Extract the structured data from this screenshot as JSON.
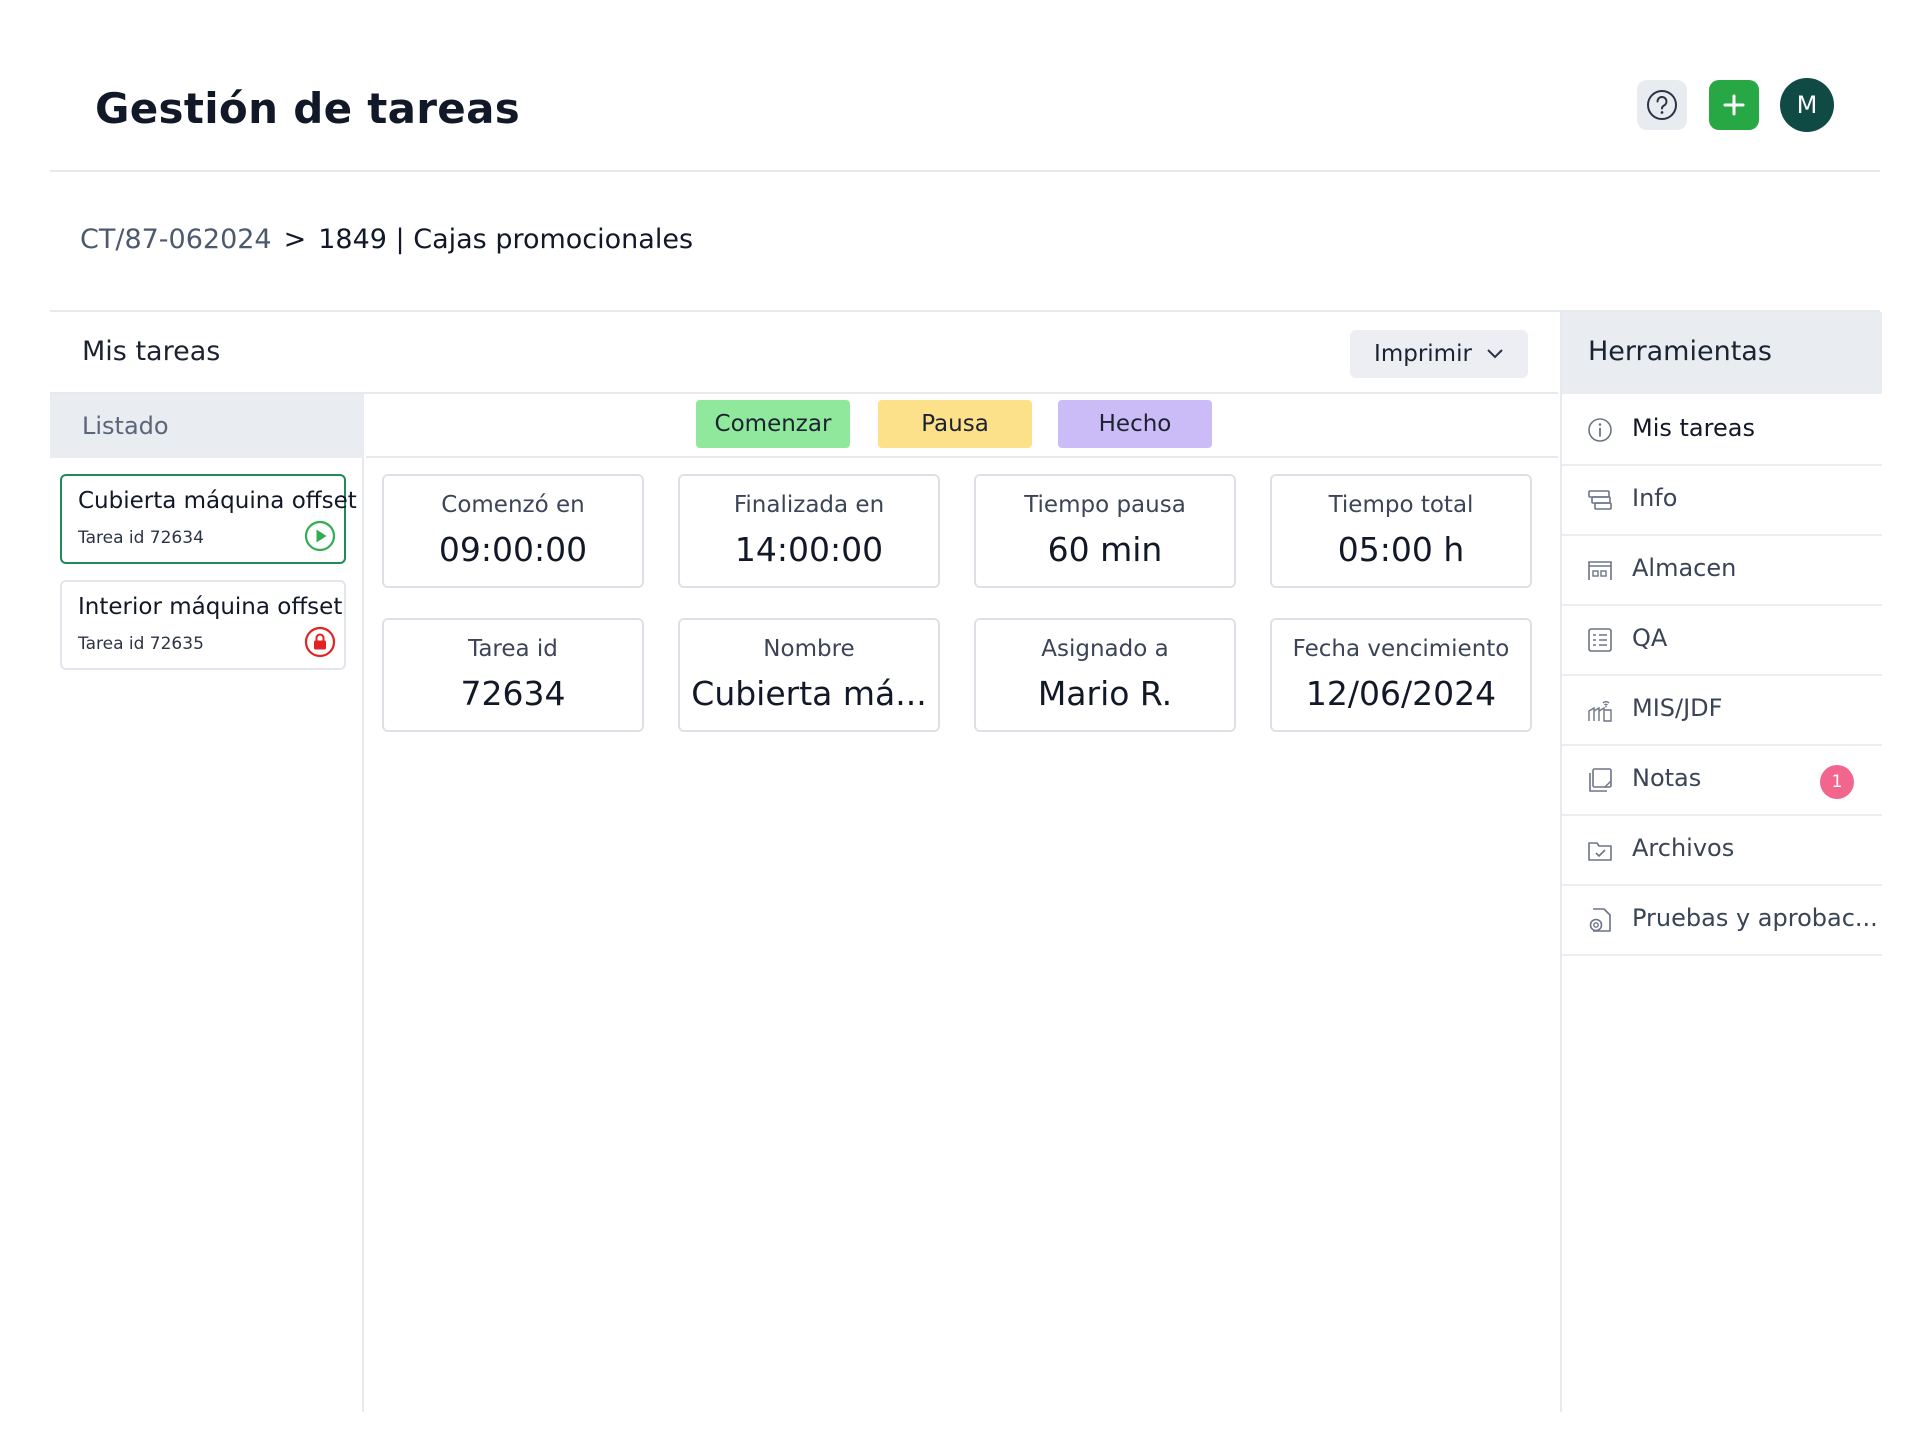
{
  "header": {
    "title": "Gestión de tareas",
    "help_icon": "question-circle-icon",
    "add_icon": "plus-icon",
    "avatar_initial": "M",
    "colors": {
      "add": "#28a745",
      "avatar": "#0f4a45"
    }
  },
  "breadcrumb": {
    "root": "CT/87-062024",
    "separator": ">",
    "current": "1849 | Cajas promocionales"
  },
  "main": {
    "title": "Mis tareas",
    "print_label": "Imprimir"
  },
  "list": {
    "header": "Listado",
    "items": [
      {
        "name": "Cubierta máquina offset",
        "id_label": "Tarea id 72634",
        "status": "play-icon"
      },
      {
        "name": "Interior máquina offset",
        "id_label": "Tarea id 72635",
        "status": "lock-icon"
      }
    ]
  },
  "actions": {
    "start": "Comenzar",
    "pause": "Pausa",
    "done": "Hecho",
    "colors": {
      "start": "#8fe89c",
      "pause": "#fde08a",
      "done": "#cbbcf8"
    }
  },
  "stats": [
    {
      "label": "Comenzó en",
      "value": "09:00:00"
    },
    {
      "label": "Finalizada en",
      "value": "14:00:00"
    },
    {
      "label": "Tiempo pausa",
      "value": "60 min"
    },
    {
      "label": "Tiempo total",
      "value": "05:00 h"
    },
    {
      "label": "Tarea id",
      "value": "72634"
    },
    {
      "label": "Nombre",
      "value": "Cubierta má..."
    },
    {
      "label": "Asignado a",
      "value": "Mario R."
    },
    {
      "label": "Fecha vencimiento",
      "value": "12/06/2024"
    }
  ],
  "tools": {
    "header": "Herramientas",
    "items": [
      {
        "label": "Mis tareas",
        "icon": "info-circle-icon"
      },
      {
        "label": "Info",
        "icon": "card-stack-icon"
      },
      {
        "label": "Almacen",
        "icon": "warehouse-icon"
      },
      {
        "label": "QA",
        "icon": "checklist-icon"
      },
      {
        "label": "MIS/JDF",
        "icon": "network-icon"
      },
      {
        "label": "Notas",
        "icon": "notes-icon",
        "badge": "1"
      },
      {
        "label": "Archivos",
        "icon": "folder-check-icon"
      },
      {
        "label": "Pruebas y aprobac...",
        "icon": "proof-document-icon"
      }
    ],
    "badge_color": "#f2668e"
  }
}
